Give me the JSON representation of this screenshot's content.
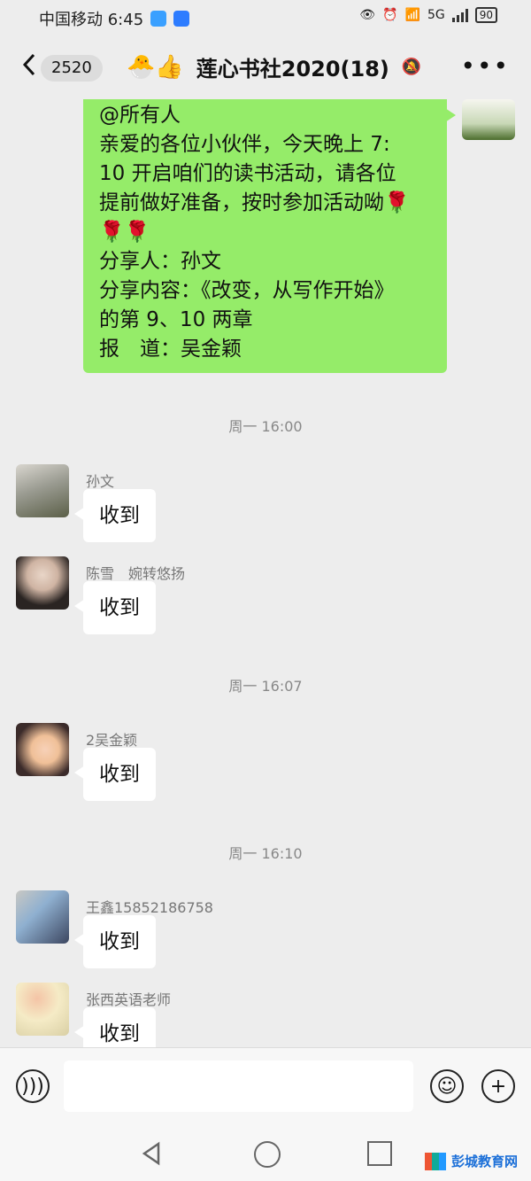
{
  "status_bar": {
    "carrier_time": "中国移动 6:45",
    "network": "5G",
    "battery": "90"
  },
  "header": {
    "unread_count": "2520",
    "emoji": "🐣👍",
    "title": "莲心书社2020(18)"
  },
  "self_message": {
    "lines": [
      "@所有人",
      "亲爱的各位小伙伴，今天晚上 7:",
      "10 开启咱们的读书活动，请各位",
      "提前做好准备，按时参加活动呦🌹",
      "🌹🌹",
      "分享人：孙文",
      "分享内容：《改变，从写作开始》",
      "的第 9、10 两章",
      "报　道：吴金颖"
    ]
  },
  "timestamps": [
    "周一 16:00",
    "周一 16:07",
    "周一 16:10"
  ],
  "messages": [
    {
      "sender": "孙文",
      "text": "收到"
    },
    {
      "sender": "陈雪　婉转悠扬",
      "text": "收到"
    },
    {
      "sender": "2吴金颖",
      "text": "收到"
    },
    {
      "sender": "王鑫15852186758",
      "text": "收到"
    },
    {
      "sender": "张西英语老师",
      "text": "收到"
    }
  ],
  "composer": {
    "placeholder": ""
  },
  "watermark": {
    "text": "彭城教育网"
  },
  "colors": {
    "self_bubble": "#95ec69",
    "background": "#ededed"
  }
}
